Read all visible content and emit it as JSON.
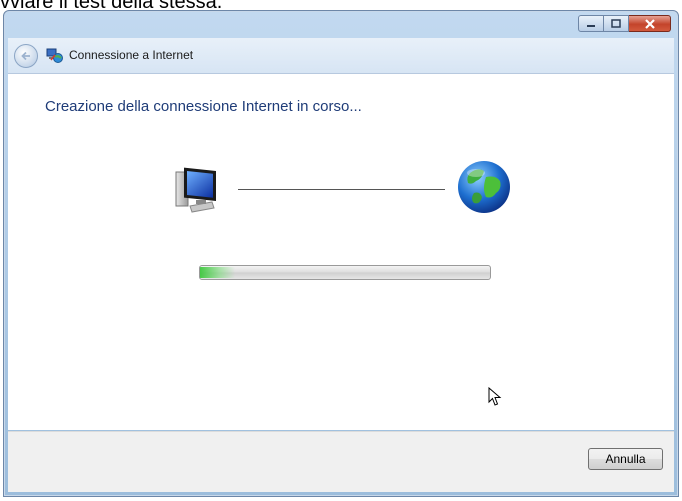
{
  "document": {
    "caption": "vviare il test della stessa."
  },
  "window": {
    "title": "Connessione a Internet",
    "controls": [
      "minimize-icon",
      "maximize-icon",
      "close-icon"
    ]
  },
  "wizard": {
    "heading": "Creazione della connessione Internet in corso...",
    "icons": [
      "computer-icon",
      "globe-icon"
    ],
    "progress": 0.12,
    "cancel_label": "Annulla"
  },
  "colors": {
    "heading": "#1f3c78",
    "progress_fill": "#36c736",
    "close_button": "#c4442b"
  }
}
